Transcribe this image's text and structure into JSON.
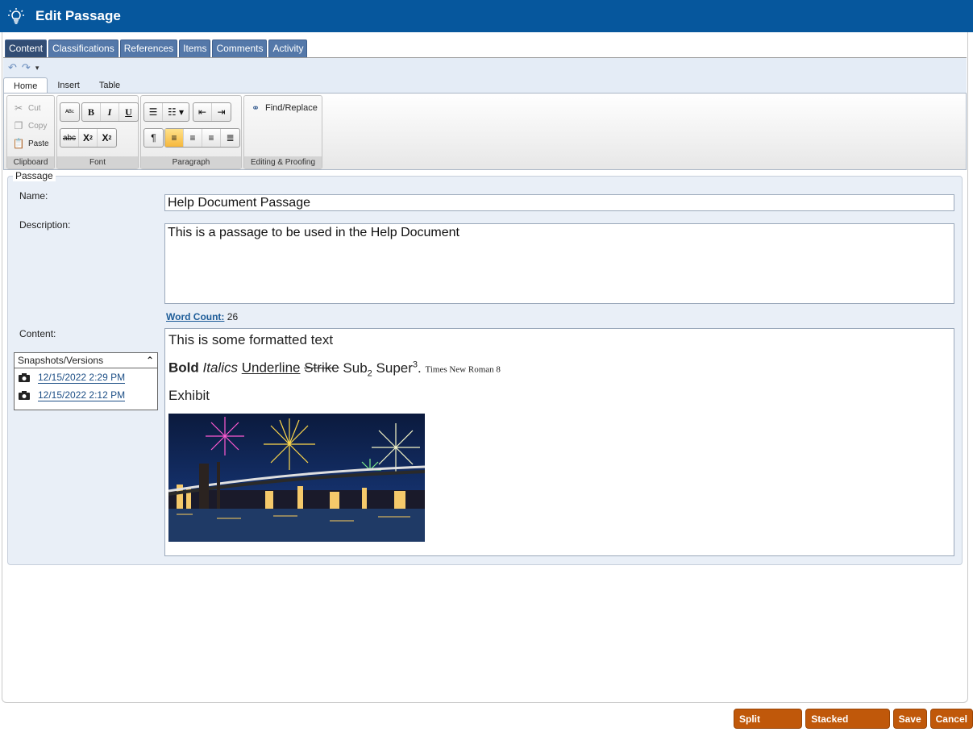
{
  "window": {
    "title": "Edit Passage"
  },
  "tabs": [
    {
      "label": "Content",
      "active": true
    },
    {
      "label": "Classifications",
      "active": false
    },
    {
      "label": "References",
      "active": false
    },
    {
      "label": "Items",
      "active": false
    },
    {
      "label": "Comments",
      "active": false
    },
    {
      "label": "Activity",
      "active": false
    }
  ],
  "ribbon": {
    "tabs": [
      "Home",
      "Insert",
      "Table"
    ],
    "clipboard": {
      "label": "Clipboard",
      "cut": "Cut",
      "copy": "Copy",
      "paste": "Paste"
    },
    "font": {
      "label": "Font"
    },
    "paragraph": {
      "label": "Paragraph"
    },
    "editing": {
      "label": "Editing & Proofing",
      "find_replace": "Find/Replace"
    }
  },
  "passage": {
    "legend": "Passage",
    "name_label": "Name:",
    "name_value": "Help Document Passage",
    "description_label": "Description:",
    "description_value": "This is a passage to be used in the Help Document",
    "word_count_label": "Word Count:",
    "word_count_value": "26",
    "content_label": "Content:"
  },
  "content": {
    "line1": "This is some formatted text",
    "bold": "Bold",
    "italics": "Italics",
    "underline": "Underline",
    "strike": "Strike",
    "sub_base": "Sub",
    "sub_script": "2",
    "super_base": "Super",
    "super_script": "3",
    "period": ".",
    "tnr": "Times New Roman 8",
    "line3": "Exhibit",
    "image_alt": "Fireworks over the Brooklyn Bridge at night"
  },
  "snapshots": {
    "header": "Snapshots/Versions",
    "items": [
      "12/15/2022 2:29 PM",
      "12/15/2022 2:12 PM"
    ]
  },
  "footer": {
    "split_preview": "Split Preview",
    "stacked_preview": "Stacked Preview",
    "save": "Save",
    "cancel": "Cancel"
  },
  "colors": {
    "titlebar": "#06579d",
    "tab": "#5478a9",
    "tab_active": "#324d74",
    "action_button": "#c0580a",
    "panel": "#e9eff7"
  }
}
